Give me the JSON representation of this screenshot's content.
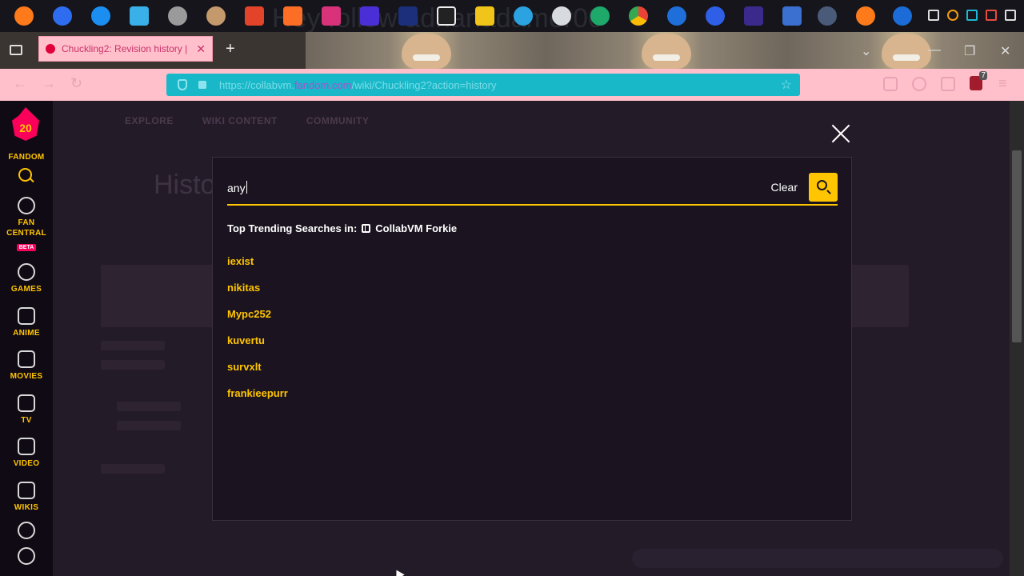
{
  "taskbar": {
    "background_text": "Hey follow adhanadamer00",
    "icons": [
      "firefox-icon",
      "firefox-icon",
      "firefox-icon",
      "wiki-w-icon",
      "raccoon-icon",
      "cat-icon",
      "gitlab-icon",
      "gitlab-icon",
      "gitlab-icon",
      "app-f-icon",
      "app-u-icon",
      "app-z-icon",
      "app-m-icon",
      "app-blue-circle-icon",
      "app-white-circle-icon",
      "app-green-icon",
      "chrome-icon",
      "app-globe-icon",
      "app-blue-globe-icon",
      "app-purple-icon",
      "app-vs-icon",
      "app-steam-icon",
      "firefox-icon",
      "edge-icon"
    ]
  },
  "browser": {
    "tab_title": "Chuckling2: Revision history | C",
    "url_prefix": "https://collabvm.",
    "url_domain": "fandom.com",
    "url_suffix": "/wiki/Chuckling2?action=history",
    "extension_count": "7"
  },
  "page": {
    "nav": [
      "EXPLORE",
      "WIKI CONTENT",
      "COMMUNITY"
    ],
    "title": "History"
  },
  "rail": {
    "logo_number": "20",
    "logo_label": "FANDOM",
    "items": [
      {
        "label_line1": "FAN",
        "label_line2": "CENTRAL",
        "badge": "BETA"
      },
      {
        "label": "GAMES"
      },
      {
        "label": "ANIME"
      },
      {
        "label": "MOVIES"
      },
      {
        "label": "TV"
      },
      {
        "label": "VIDEO"
      },
      {
        "label": "WIKIS"
      }
    ]
  },
  "search": {
    "query": "any",
    "clear_label": "Clear",
    "trending_prefix": "Top Trending Searches in:",
    "trending_wiki": "CollabVM Forkie",
    "trending": [
      "iexist",
      "nikitas",
      "Mypc252",
      "kuvertu",
      "survxlt",
      "frankieepurr"
    ]
  },
  "colors": {
    "accent_yellow": "#ffc500",
    "fandom_pink": "#fa005a",
    "browser_theme_pink": "#ffc0cb",
    "url_bar_cyan": "#19b8c8"
  }
}
